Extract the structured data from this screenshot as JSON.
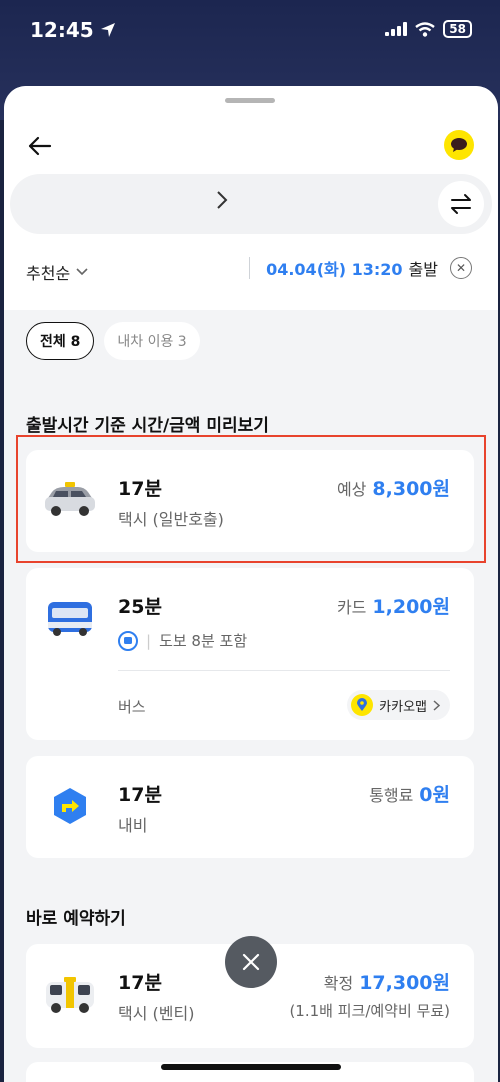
{
  "status": {
    "time": "12:45",
    "battery": "58"
  },
  "header": {
    "route_text": ""
  },
  "sort": {
    "label": "추천순"
  },
  "departure": {
    "date_time": "04.04(화) 13:20",
    "suffix": "출발"
  },
  "filters": [
    {
      "label": "전체 8",
      "active": true
    },
    {
      "label": "내차 이용 3",
      "active": false
    }
  ],
  "sections": {
    "preview_title": "출발시간 기준 시간/금액 미리보기",
    "reserve_title": "바로 예약하기"
  },
  "cards": [
    {
      "duration": "17분",
      "subtitle": "택시 (일반호출)",
      "price_label": "예상",
      "price": "8,300원",
      "icon": "taxi-icon"
    },
    {
      "duration": "25분",
      "walk": "도보 8분 포함",
      "type_label": "버스",
      "map_button": "카카오맵",
      "price_label": "카드",
      "price": "1,200원",
      "icon": "bus-icon"
    },
    {
      "duration": "17분",
      "subtitle": "내비",
      "price_label": "통행료",
      "price": "0원",
      "icon": "navi-icon"
    },
    {
      "duration": "17분",
      "subtitle": "택시 (벤티)",
      "price_label": "확정",
      "price": "17,300원",
      "note": "(1.1배 피크/예약비 무료)",
      "icon": "venti-taxi-icon"
    }
  ],
  "colors": {
    "accent": "#2f7ff0",
    "kakao_yellow": "#fee500",
    "highlight": "#e8432d"
  }
}
